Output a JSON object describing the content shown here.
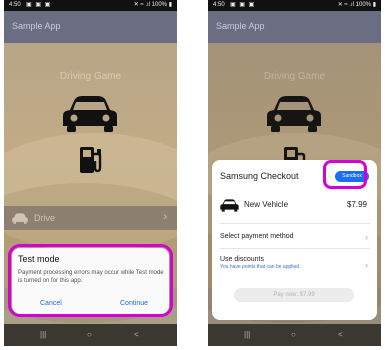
{
  "left": {
    "status": {
      "time": "4:50",
      "icons": "▣ ▣ ▣",
      "signal": "✕ ≈ .ıl 100% ▮"
    },
    "app_title": "Sample App",
    "game_title": "Driving Game",
    "drive_label": "Drive",
    "drive_chevron": "›",
    "dialog": {
      "title": "Test mode",
      "message": "Payment processing errors may occur while Test mode is turned on for this app.",
      "cancel": "Cancel",
      "continue": "Continue"
    },
    "nav": {
      "recent": "|||",
      "home": "○",
      "back": "<"
    }
  },
  "right": {
    "status": {
      "time": "4:50",
      "icons": "▣ ▣ ▣",
      "signal": "✕ ≈ .ıl 100% ▮"
    },
    "app_title": "Sample App",
    "game_title": "Driving Game",
    "checkout": {
      "title": "Samsung Checkout",
      "sandbox": "Sandbox",
      "product_name": "New Vehicle",
      "price": "$7.99",
      "payment_method": "Select payment method",
      "discounts": "Use discounts",
      "discounts_note": "You have points that can be applied.",
      "pay_button": "Pay now: $7.99",
      "chevron": "›"
    },
    "nav": {
      "recent": "|||",
      "home": "○",
      "back": "<"
    }
  },
  "colors": {
    "highlight": "#d400d8",
    "link": "#1e6cd6",
    "sandbox": "#1a6ff0",
    "app_bar": "#6b6e82"
  },
  "icons": [
    "car-icon",
    "fuel-pump-icon"
  ]
}
